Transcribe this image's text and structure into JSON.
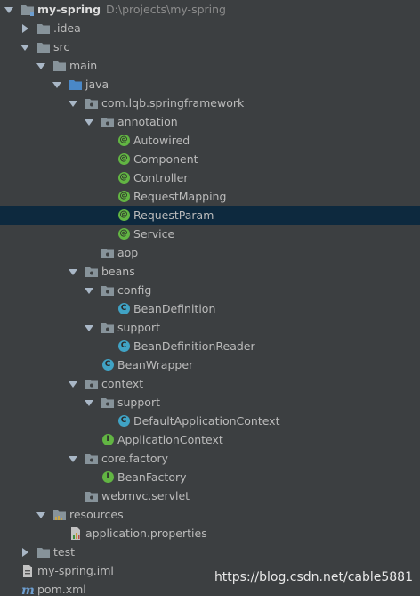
{
  "project": {
    "name": "my-spring",
    "path": "D:\\projects\\my-spring"
  },
  "tree": [
    {
      "label": "my-spring",
      "type": "project",
      "expanded": true,
      "icon": "project-folder-icon"
    },
    {
      "label": ".idea",
      "type": "folder",
      "expanded": false,
      "icon": "folder-icon"
    },
    {
      "label": "src",
      "type": "folder",
      "expanded": true,
      "icon": "folder-icon"
    },
    {
      "label": "main",
      "type": "folder",
      "expanded": true,
      "icon": "folder-icon"
    },
    {
      "label": "java",
      "type": "source-root",
      "expanded": true,
      "icon": "source-folder-icon"
    },
    {
      "label": "com.lqb.springframework",
      "type": "package",
      "expanded": true,
      "icon": "package-icon"
    },
    {
      "label": "annotation",
      "type": "package",
      "expanded": true,
      "icon": "package-icon"
    },
    {
      "label": "Autowired",
      "type": "annotation",
      "badge": "@",
      "icon": "annotation-icon"
    },
    {
      "label": "Component",
      "type": "annotation",
      "badge": "@",
      "icon": "annotation-icon"
    },
    {
      "label": "Controller",
      "type": "annotation",
      "badge": "@",
      "icon": "annotation-icon"
    },
    {
      "label": "RequestMapping",
      "type": "annotation",
      "badge": "@",
      "icon": "annotation-icon"
    },
    {
      "label": "RequestParam",
      "type": "annotation",
      "badge": "@",
      "icon": "annotation-icon",
      "selected": true
    },
    {
      "label": "Service",
      "type": "annotation",
      "badge": "@",
      "icon": "annotation-icon"
    },
    {
      "label": "aop",
      "type": "package",
      "icon": "package-icon"
    },
    {
      "label": "beans",
      "type": "package",
      "expanded": true,
      "icon": "package-icon"
    },
    {
      "label": "config",
      "type": "package",
      "expanded": true,
      "icon": "package-icon"
    },
    {
      "label": "BeanDefinition",
      "type": "class",
      "badge": "C",
      "icon": "class-icon"
    },
    {
      "label": "support",
      "type": "package",
      "expanded": true,
      "icon": "package-icon"
    },
    {
      "label": "BeanDefinitionReader",
      "type": "class",
      "badge": "C",
      "icon": "class-icon"
    },
    {
      "label": "BeanWrapper",
      "type": "class",
      "badge": "C",
      "icon": "class-icon"
    },
    {
      "label": "context",
      "type": "package",
      "expanded": true,
      "icon": "package-icon"
    },
    {
      "label": "support",
      "type": "package",
      "expanded": true,
      "icon": "package-icon"
    },
    {
      "label": "DefaultApplicationContext",
      "type": "class",
      "badge": "C",
      "icon": "class-icon"
    },
    {
      "label": "ApplicationContext",
      "type": "interface",
      "badge": "I",
      "icon": "interface-icon"
    },
    {
      "label": "core.factory",
      "type": "package",
      "expanded": true,
      "icon": "package-icon"
    },
    {
      "label": "BeanFactory",
      "type": "interface",
      "badge": "I",
      "icon": "interface-icon"
    },
    {
      "label": "webmvc.servlet",
      "type": "package",
      "icon": "package-icon"
    },
    {
      "label": "resources",
      "type": "resources-root",
      "expanded": true,
      "icon": "resources-folder-icon"
    },
    {
      "label": "application.properties",
      "type": "properties",
      "icon": "properties-file-icon"
    },
    {
      "label": "test",
      "type": "folder",
      "expanded": false,
      "icon": "folder-icon"
    },
    {
      "label": "my-spring.iml",
      "type": "iml",
      "icon": "iml-file-icon"
    },
    {
      "label": "pom.xml",
      "type": "maven",
      "icon": "maven-file-icon"
    }
  ],
  "watermark": "https://blog.csdn.net/cable5881"
}
